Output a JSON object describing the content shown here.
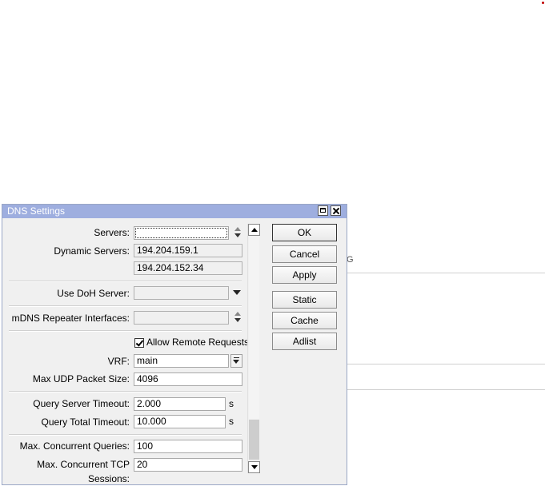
{
  "window": {
    "title": "DNS Settings"
  },
  "form": {
    "servers_label": "Servers:",
    "servers_value": "",
    "dynamic_servers_label": "Dynamic Servers:",
    "dynamic_servers": [
      "194.204.159.1",
      "194.204.152.34"
    ],
    "use_doh_label": "Use DoH Server:",
    "use_doh_value": "",
    "mdns_label": "mDNS Repeater Interfaces:",
    "mdns_value": "",
    "allow_remote_label": "Allow Remote Requests",
    "allow_remote_checked": true,
    "vrf_label": "VRF:",
    "vrf_value": "main",
    "max_udp_label": "Max UDP Packet Size:",
    "max_udp_value": "4096",
    "query_server_timeout_label": "Query Server Timeout:",
    "query_server_timeout_value": "2.000",
    "query_total_timeout_label": "Query Total Timeout:",
    "query_total_timeout_value": "10.000",
    "unit_s": "s",
    "max_concurrent_queries_label": "Max. Concurrent Queries:",
    "max_concurrent_queries_value": "100",
    "max_concurrent_tcp_label": "Max. Concurrent TCP Sessions:",
    "max_concurrent_tcp_value": "20"
  },
  "buttons": {
    "ok": "OK",
    "cancel": "Cancel",
    "apply": "Apply",
    "static": "Static",
    "cache": "Cache",
    "adlist": "Adlist"
  },
  "background": {
    "fragment_glyph": "G"
  },
  "colors": {
    "titlebar": "#9eaedf",
    "window_bg": "#f0f0f0",
    "accent_dot": "#c00000"
  },
  "icons": [
    "maximize-icon",
    "close-icon",
    "updown-icon",
    "dropdown-arrow-icon",
    "scroll-up-icon",
    "scroll-down-icon",
    "checkmark-icon"
  ]
}
